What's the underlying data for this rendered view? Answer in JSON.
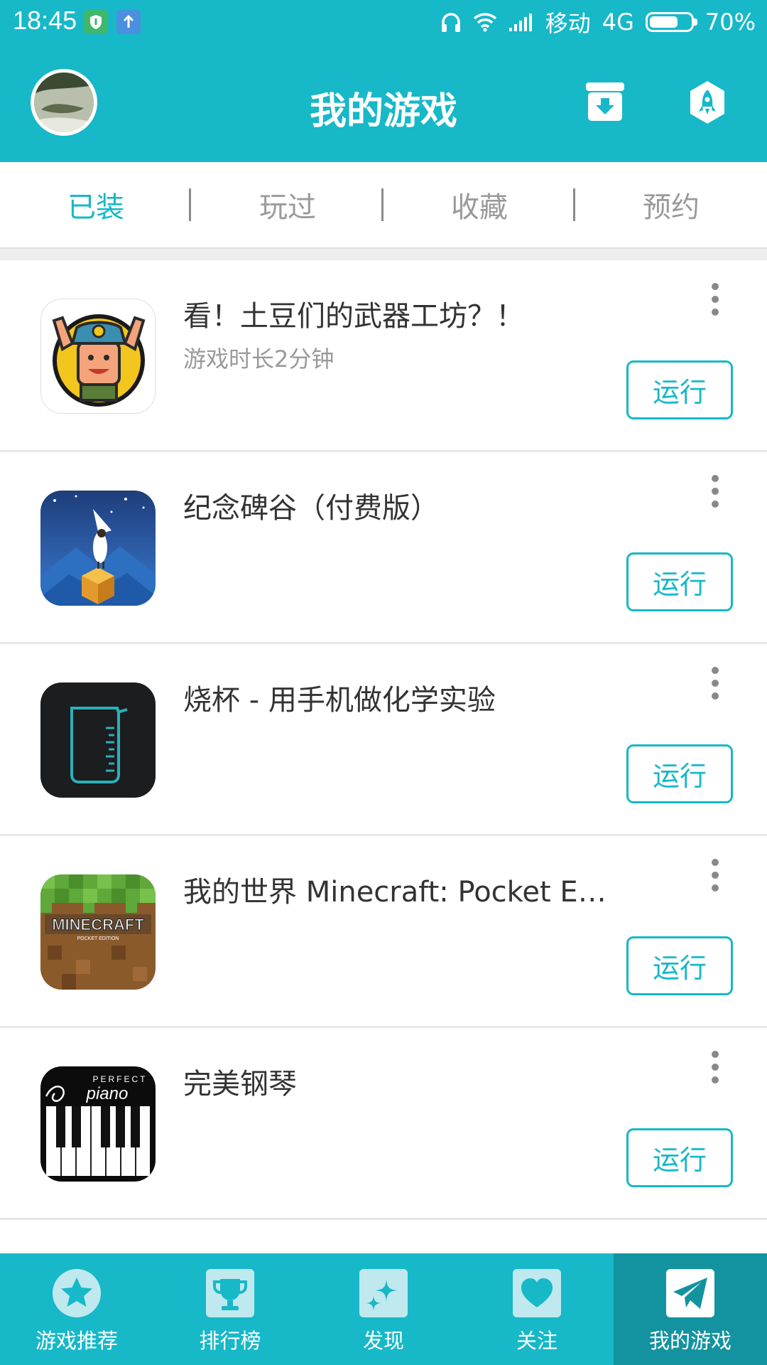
{
  "status_bar": {
    "time": "18:45",
    "carrier": "移动",
    "network": "4G",
    "battery": "70%",
    "battery_level": 0.7,
    "icons": [
      "shield-icon",
      "upload-arrow-icon",
      "headphones-icon",
      "wifi-icon",
      "signal-icon",
      "battery-icon"
    ]
  },
  "header": {
    "title": "我的游戏",
    "icons": [
      "avatar",
      "download-box-icon",
      "rocket-icon"
    ]
  },
  "tabs": [
    {
      "label": "已装",
      "active": true
    },
    {
      "label": "玩过",
      "active": false
    },
    {
      "label": "收藏",
      "active": false
    },
    {
      "label": "预约",
      "active": false
    }
  ],
  "games": [
    {
      "title": "看！土豆们的武器工坊？！",
      "subtitle": "游戏时长2分钟",
      "action": "运行",
      "icon": "potato-cowboy-icon"
    },
    {
      "title": "纪念碑谷（付费版）",
      "subtitle": "",
      "action": "运行",
      "icon": "monument-valley-icon"
    },
    {
      "title": "烧杯 - 用手机做化学实验",
      "subtitle": "",
      "action": "运行",
      "icon": "beaker-icon"
    },
    {
      "title": "我的世界 Minecraft: Pocket Ed...",
      "subtitle": "",
      "action": "运行",
      "icon": "minecraft-icon"
    },
    {
      "title": "完美钢琴",
      "subtitle": "",
      "action": "运行",
      "icon": "piano-icon"
    }
  ],
  "bottom_nav": [
    {
      "label": "游戏推荐",
      "icon": "star-icon",
      "active": false
    },
    {
      "label": "排行榜",
      "icon": "trophy-icon",
      "active": false
    },
    {
      "label": "发现",
      "icon": "sparkle-icon",
      "active": false
    },
    {
      "label": "关注",
      "icon": "heart-icon",
      "active": false
    },
    {
      "label": "我的游戏",
      "icon": "paper-plane-icon",
      "active": true
    }
  ],
  "colors": {
    "accent": "#17b8c8",
    "nav_active": "#13939f",
    "text_primary": "#333333",
    "text_secondary": "#9a9a9a"
  }
}
